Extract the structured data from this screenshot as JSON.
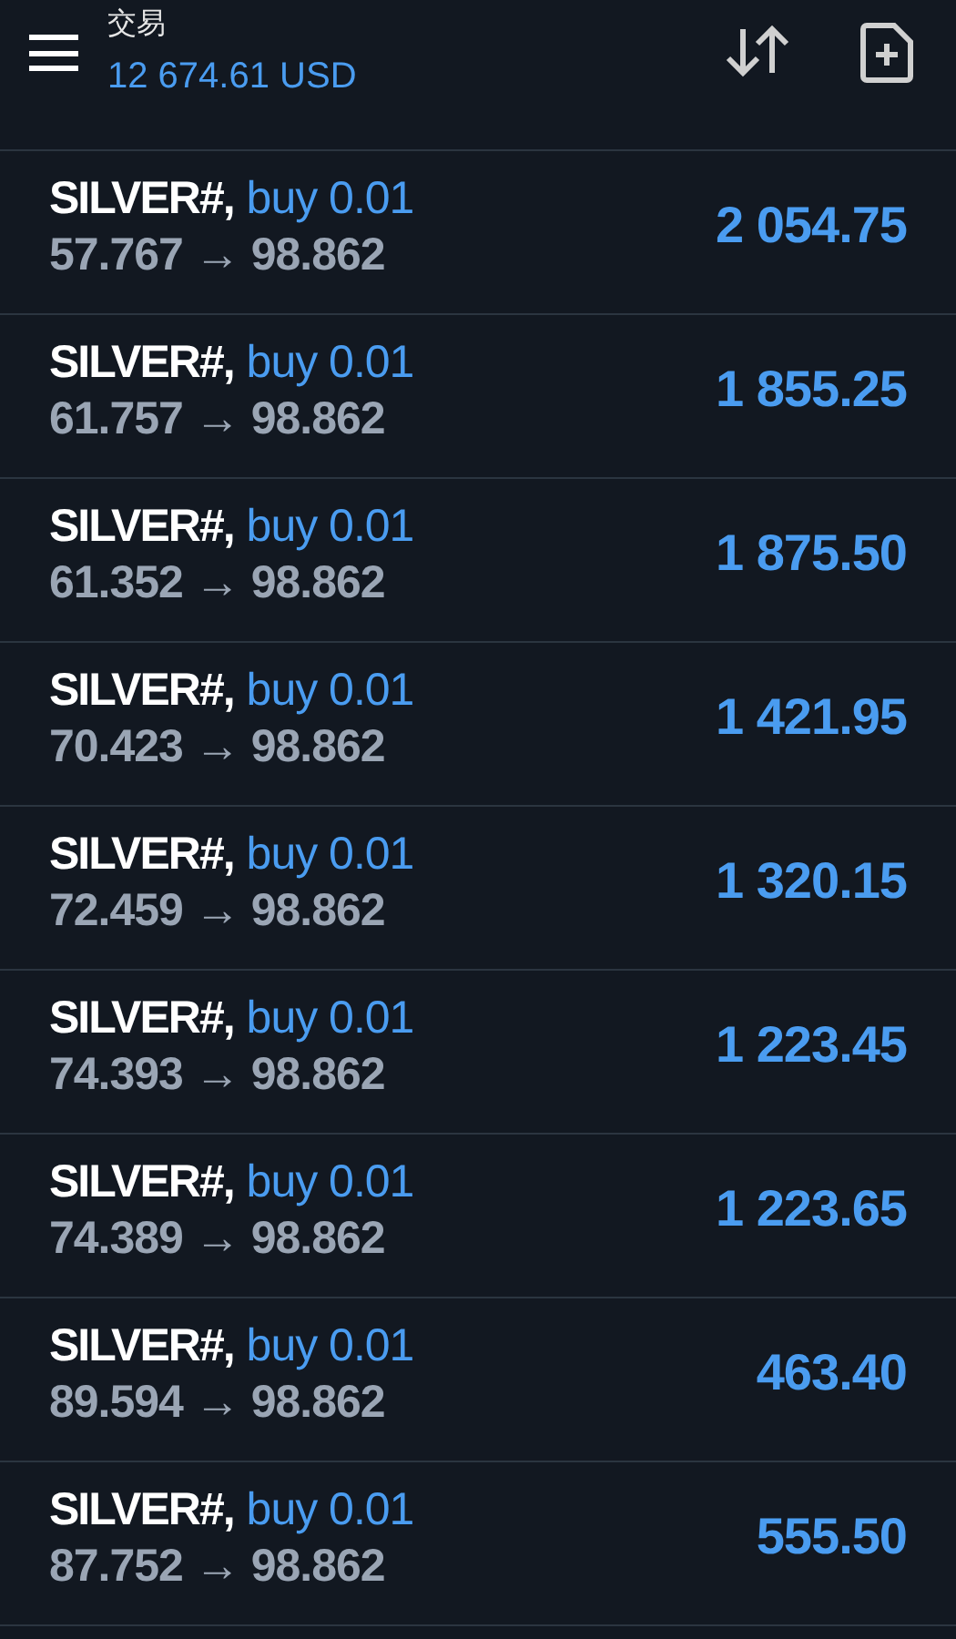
{
  "header": {
    "title": "交易",
    "balance": "12 674.61 USD"
  },
  "positions": [
    {
      "symbol": "SILVER#,",
      "order": "buy 0.01",
      "prices": "57.767 → 98.862",
      "profit": "2 054.75"
    },
    {
      "symbol": "SILVER#,",
      "order": "buy 0.01",
      "prices": "61.757 → 98.862",
      "profit": "1 855.25"
    },
    {
      "symbol": "SILVER#,",
      "order": "buy 0.01",
      "prices": "61.352 → 98.862",
      "profit": "1 875.50"
    },
    {
      "symbol": "SILVER#,",
      "order": "buy 0.01",
      "prices": "70.423 → 98.862",
      "profit": "1 421.95"
    },
    {
      "symbol": "SILVER#,",
      "order": "buy 0.01",
      "prices": "72.459 → 98.862",
      "profit": "1 320.15"
    },
    {
      "symbol": "SILVER#,",
      "order": "buy 0.01",
      "prices": "74.393 → 98.862",
      "profit": "1 223.45"
    },
    {
      "symbol": "SILVER#,",
      "order": "buy 0.01",
      "prices": "74.389 → 98.862",
      "profit": "1 223.65"
    },
    {
      "symbol": "SILVER#,",
      "order": "buy 0.01",
      "prices": "89.594 → 98.862",
      "profit": "463.40"
    },
    {
      "symbol": "SILVER#,",
      "order": "buy 0.01",
      "prices": "87.752 → 98.862",
      "profit": "555.50"
    }
  ]
}
